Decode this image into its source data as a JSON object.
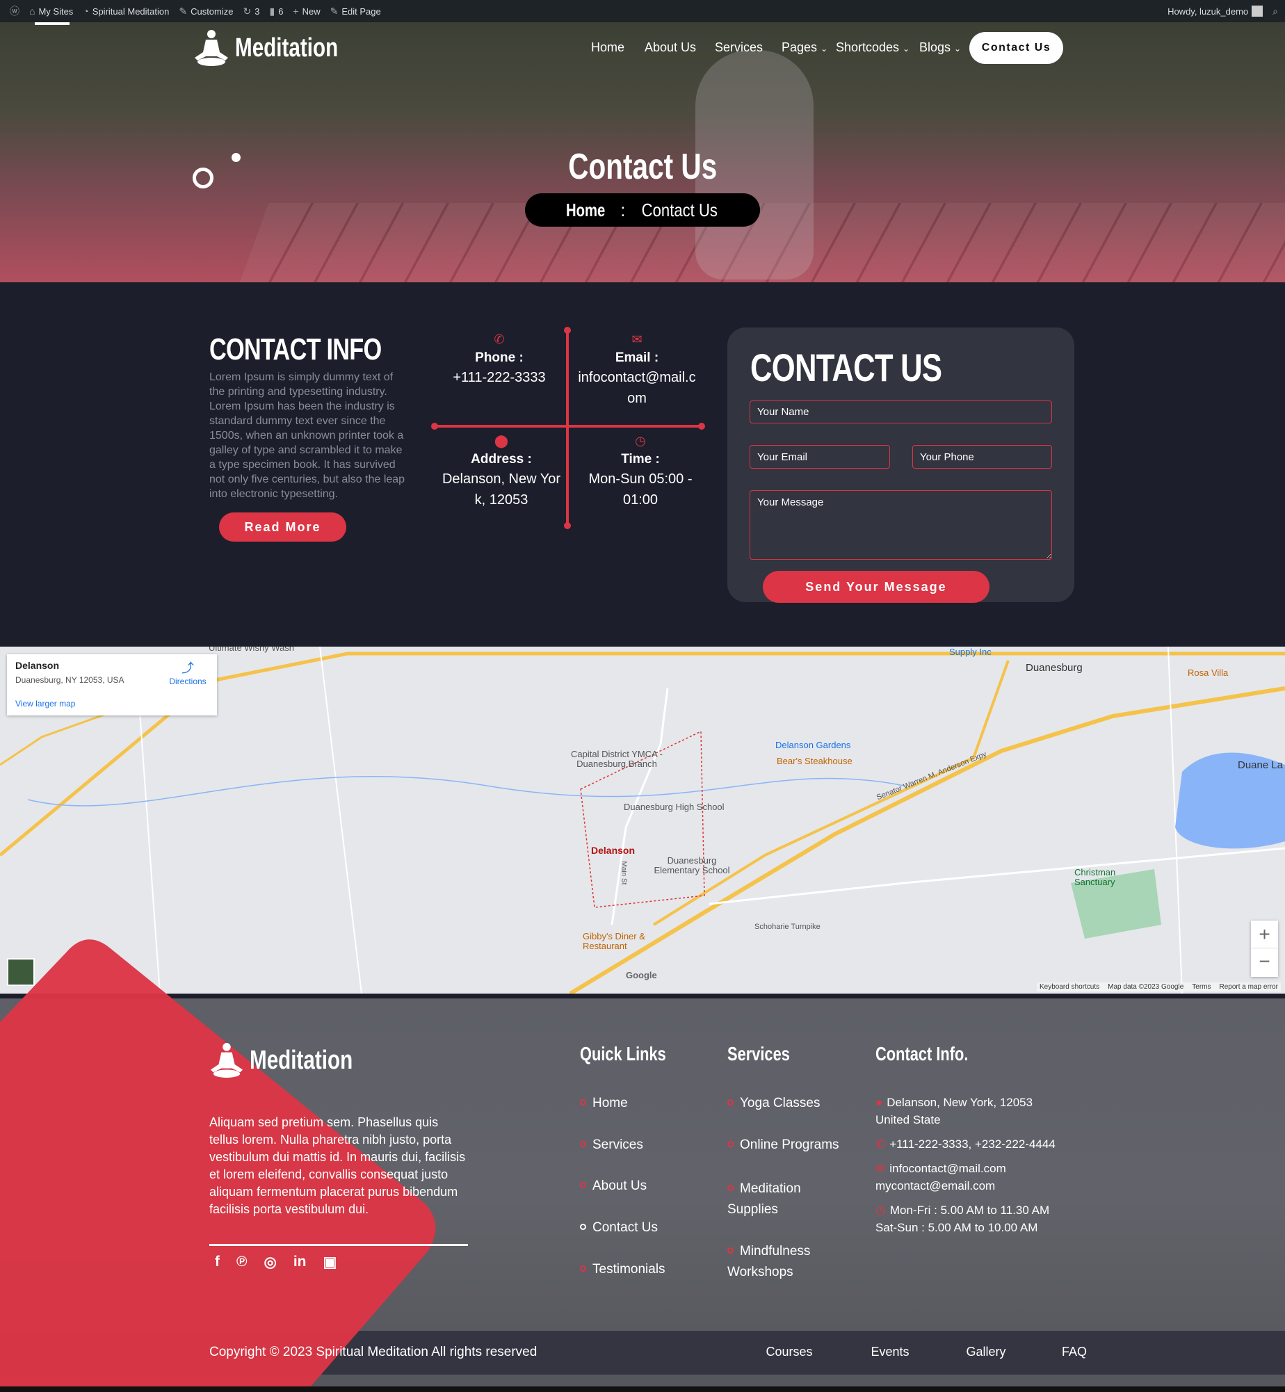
{
  "admin_bar": {
    "items": [
      "My Sites",
      "Spiritual Meditation",
      "Customize",
      "3",
      "6",
      "New",
      "Edit Page"
    ],
    "greeting": "Howdy, luzuk_demo"
  },
  "header": {
    "logo": "Meditation",
    "nav": [
      "Home",
      "About Us",
      "Services",
      "Pages",
      "Shortcodes",
      "Blogs"
    ],
    "nav_dropdowns": [
      "Pages",
      "Shortcodes",
      "Blogs"
    ],
    "cta": "Contact Us"
  },
  "hero": {
    "title": "Contact Us",
    "breadcrumb": {
      "home": "Home",
      "separator": ":",
      "current": "Contact Us"
    }
  },
  "contact_info": {
    "title": "CONTACT INFO",
    "text": "Lorem Ipsum is simply dummy text of the printing and typesetting industry. Lorem Ipsum has been the industry is standard dummy text ever since the 1500s, when an unknown printer took a galley of type and scrambled it to make a type specimen book. It has survived not only five centuries, but also the leap into electronic typesetting.",
    "read_more": "Read More",
    "cells": [
      {
        "icon": "phone-icon",
        "label": "Phone :",
        "value": "+111-222-3333"
      },
      {
        "icon": "envelope-icon",
        "label": "Email :",
        "value": "infocontact@mail.com"
      },
      {
        "icon": "map-pin-icon",
        "label": "Address :",
        "value": "Delanson, New York, 12053"
      },
      {
        "icon": "clock-icon",
        "label": "Time :",
        "value": "Mon-Sun 05:00 - 01:00"
      }
    ]
  },
  "form": {
    "title": "CONTACT US",
    "name_placeholder": "Your Name",
    "email_placeholder": "Your Email",
    "phone_placeholder": "Your Phone",
    "message_placeholder": "Your Message",
    "submit": "Send Your Message"
  },
  "map": {
    "place": "Delanson",
    "address": "Duanesburg, NY 12053, USA",
    "directions": "Directions",
    "larger_map": "View larger map",
    "labels": [
      "Duanesburg",
      "Delanson Gardens",
      "Bear's Steakhouse",
      "Capital District YMCA - Duanesburg Branch",
      "Duanesburg High School",
      "Delanson",
      "Duanesburg Elementary School",
      "Gibby's Diner & Restaurant",
      "Christman Sanctuary",
      "Duane La",
      "Supply Inc",
      "Rosa Villa",
      "Senator Warren M. Anderson Expy",
      "Schoharie Turnpike",
      "Main St",
      "Ultimate Wishy Wash",
      "Google"
    ],
    "attribution": [
      "Keyboard shortcuts",
      "Map data ©2023 Google",
      "Terms",
      "Report a map error"
    ]
  },
  "footer": {
    "logo": "Meditation",
    "text": "Aliquam sed pretium sem. Phasellus quis tellus lorem. Nulla pharetra nibh justo, porta vestibulum dui mattis id. In mauris dui, facilisis et lorem eleifend, convallis consequat justo aliquam fermentum placerat purus bibendum facilisis porta vestibulum dui.",
    "social": [
      "facebook-icon",
      "pinterest-icon",
      "instagram-icon",
      "linkedin-icon",
      "youtube-icon"
    ],
    "quick_links": {
      "title": "Quick Links",
      "items": [
        "Home",
        "Services",
        "About Us",
        "Contact Us",
        "Testimonials"
      ]
    },
    "services": {
      "title": "Services",
      "items": [
        "Yoga Classes",
        "Online Programs",
        "Meditation Supplies",
        "Mindfulness Workshops"
      ]
    },
    "contact": {
      "title": "Contact Info.",
      "address": [
        "Delanson, New York, 12053",
        "United State"
      ],
      "phone": "+111-222-3333, +232-222-4444",
      "email": [
        "infocontact@mail.com",
        "mycontact@email.com"
      ],
      "hours": [
        "Mon-Fri : 5.00 AM to 11.30 AM",
        "Sat-Sun : 5.00 AM to 10.00 AM"
      ]
    },
    "copyright": "Copyright © 2023 Spiritual Meditation All rights reserved",
    "bottom_links": [
      "Courses",
      "Events",
      "Gallery",
      "FAQ"
    ]
  },
  "colors": {
    "accent": "#dc3545",
    "dark_bg": "#1c1f2b",
    "card_bg": "#323440"
  }
}
